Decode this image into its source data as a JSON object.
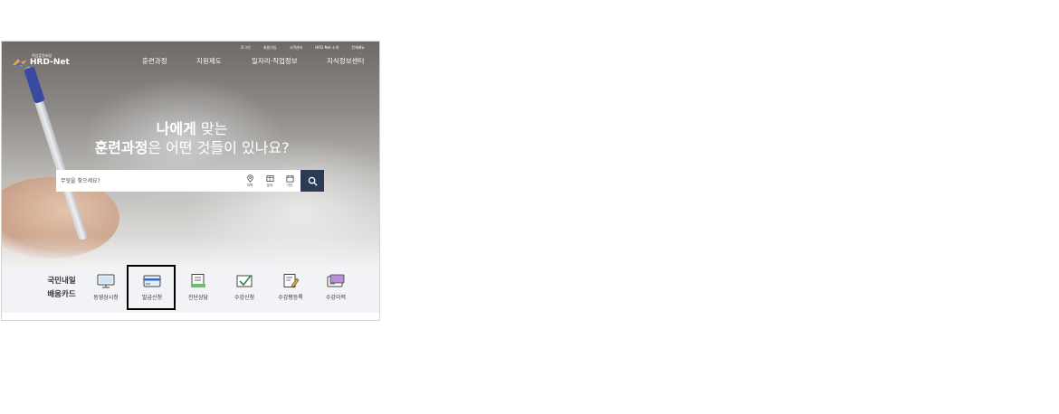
{
  "util_links": [
    "로그인",
    "회원가입",
    "고객센터",
    "HRD-Net 소개",
    "전체메뉴"
  ],
  "logo": {
    "tag": "직업훈련포털",
    "name": "HRD-Net"
  },
  "nav": [
    "훈련과정",
    "지원제도",
    "일자리·직업정보",
    "지식정보센터"
  ],
  "headline": {
    "line1_bold": "나에게",
    "line1_light": " 맞는",
    "line2_bold": "훈련과정",
    "line2_light": "은 어떤 것들이 있나요?"
  },
  "search": {
    "placeholder": "무엇을 찾으세요?",
    "filters": [
      "지역",
      "분야",
      "기간"
    ]
  },
  "card": {
    "title_line1": "국민내일",
    "title_line2": "배움카드",
    "items": [
      "동영상시청",
      "발급신청",
      "진단상담",
      "수강신청",
      "수강평등록",
      "수강이력"
    ]
  },
  "colors": {
    "search_button": "#2b3a55",
    "card_bar_bg": "#f2f3f6",
    "highlight_border": "#000000"
  }
}
